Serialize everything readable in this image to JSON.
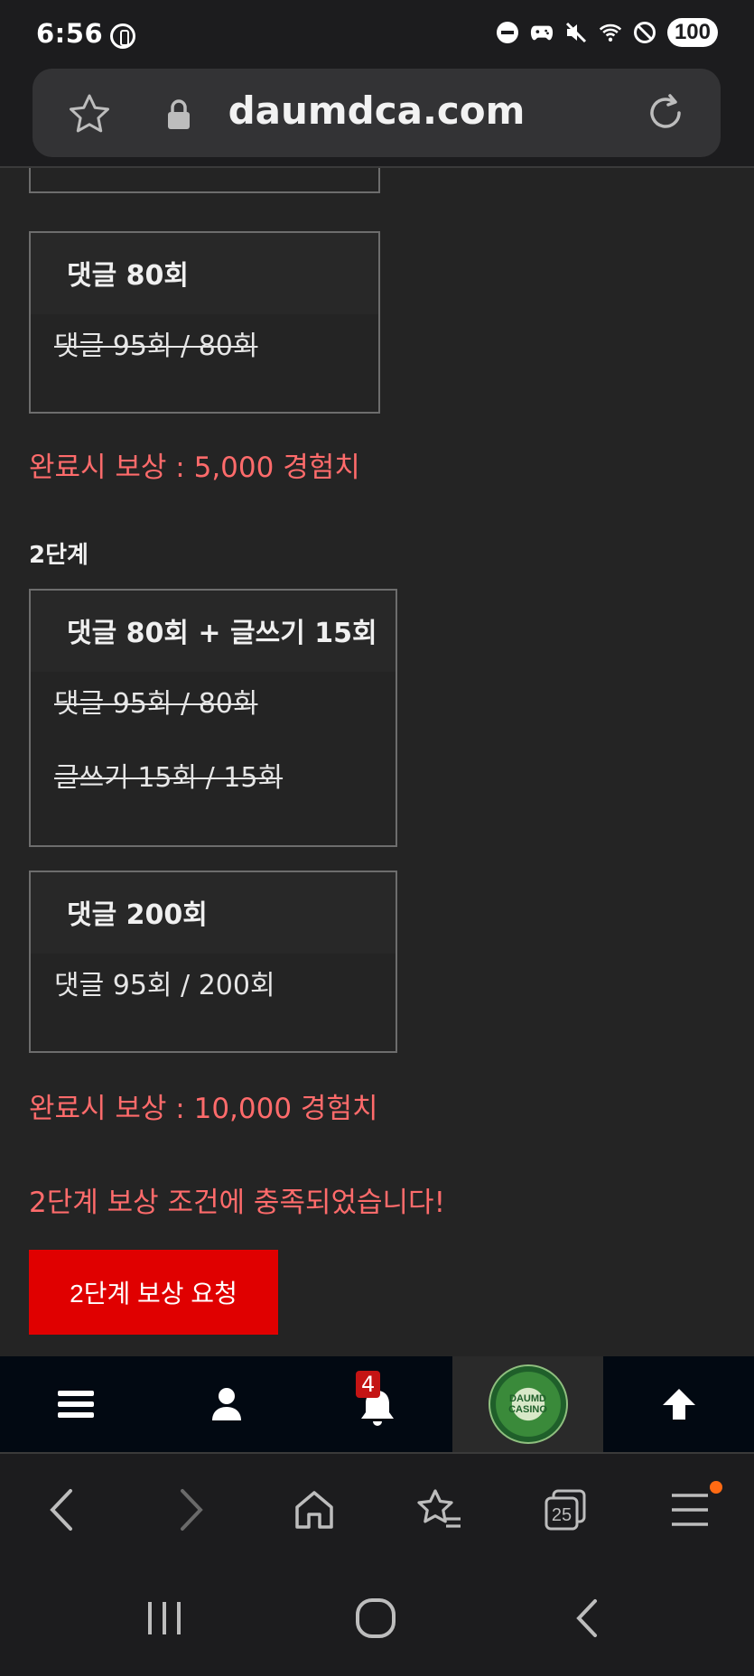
{
  "status_bar": {
    "time": "6:56",
    "battery": "100",
    "icons": [
      "dnd-icon",
      "game-icon",
      "mute-icon",
      "wifi-icon",
      "block-icon"
    ]
  },
  "browser": {
    "url": "daumdca.com"
  },
  "missions": {
    "stage1_last_box": {
      "title": "댓글 80회",
      "lines": [
        "댓글 95회 / 80회"
      ]
    },
    "stage1_reward": "완료시 보상 : 5,000 경험치",
    "stage2_label": "2단계",
    "stage2_box1": {
      "title": "댓글 80회 + 글쓰기 15회",
      "lines": [
        "댓글 95회 / 80회",
        "글쓰기 15회 / 15회"
      ]
    },
    "stage2_box2": {
      "title": "댓글 200회",
      "lines": [
        "댓글 95회 / 200회"
      ]
    },
    "stage2_reward": "완료시 보상 : 10,000 경험치",
    "stage2_notice": "2단계 보상 조건에 충족되었습니다!",
    "claim_button": "2단계 보상 요청"
  },
  "site_nav": {
    "notification_count": "4",
    "logo_line1": "DAUMD",
    "logo_line2": "CASINO"
  },
  "browser_toolbar": {
    "tabs_count": "25"
  },
  "colors": {
    "accent_red": "#e00000",
    "reward_text": "#ff6b6b",
    "background": "#242424"
  }
}
